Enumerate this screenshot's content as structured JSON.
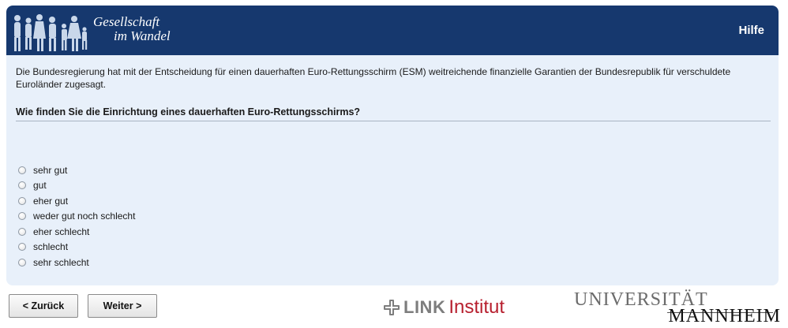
{
  "header": {
    "logo_line1": "Gesellschaft",
    "logo_line2": "im Wandel",
    "help_label": "Hilfe",
    "background": "#16386e"
  },
  "survey": {
    "intro": "Die Bundesregierung hat mit der Entscheidung für einen dauerhaften Euro-Rettungsschirm (ESM) weitreichende finanzielle Garantien der Bundesrepublik für verschuldete Euroländer zugesagt.",
    "question": "Wie finden Sie die Einrichtung eines dauerhaften Euro-Rettungsschirms?",
    "options": [
      {
        "label": "sehr gut"
      },
      {
        "label": "gut"
      },
      {
        "label": "eher gut"
      },
      {
        "label": "weder gut noch schlecht"
      },
      {
        "label": "eher schlecht"
      },
      {
        "label": "schlecht"
      },
      {
        "label": "sehr schlecht"
      }
    ]
  },
  "navigation": {
    "back_label": "< Zurück",
    "next_label": "Weiter >"
  },
  "footer": {
    "link_word": "LINK",
    "link_institut": "Institut",
    "uni_line1": "UNIVERSITÄT",
    "uni_line2": "MANNHEIM",
    "link_color": "#b71f2e"
  }
}
